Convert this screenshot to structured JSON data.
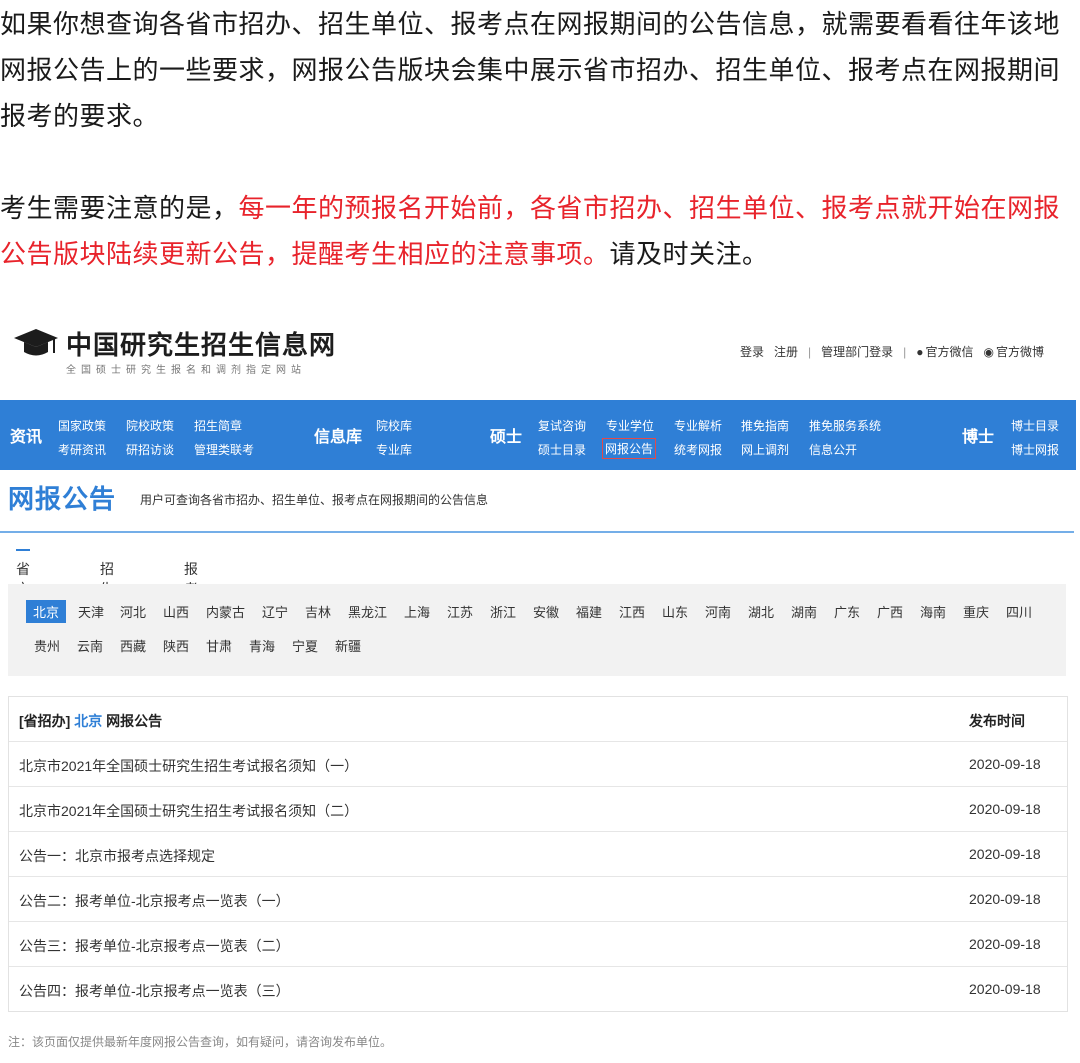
{
  "article": {
    "paragraph1": "如果你想查询各省市招办、招生单位、报考点在网报期间的公告信息，就需要看看往年该地网报公告上的一些要求，网报公告版块会集中展示省市招办、招生单位、报考点在网报期间报考的要求。",
    "p2_prefix": "考生需要注意的是，",
    "p2_red": "每一年的预报名开始前，各省市招办、招生单位、报考点就开始在网报公告版块陆续更新公告，提醒考生相应的注意事项。",
    "p2_suffix": "请及时关注。"
  },
  "site": {
    "logo_title": "中国研究生招生信息网",
    "logo_sub": "全国硕士研究生报名和调剂指定网站",
    "top_links": [
      "登录",
      "注册",
      "管理部门登录",
      "官方微信",
      "官方微博"
    ]
  },
  "nav": {
    "zixun": "资讯",
    "zixun_items": [
      "国家政策",
      "院校政策",
      "招生简章",
      "考研资讯",
      "研招访谈",
      "管理类联考"
    ],
    "xinxiku": "信息库",
    "xinxiku_items": [
      "院校库",
      "专业库"
    ],
    "shuoshi": "硕士",
    "shuoshi_items": [
      "复试咨询",
      "专业学位",
      "专业解析",
      "推免指南",
      "推免服务系统",
      "硕士目录",
      "网报公告",
      "统考网报",
      "网上调剂",
      "信息公开"
    ],
    "boshi": "博士",
    "boshi_items": [
      "博士目录",
      "博士网报"
    ]
  },
  "page": {
    "title": "网报公告",
    "desc": "用户可查询各省市招办、招生单位、报考点在网报期间的公告信息"
  },
  "tabs": [
    "省市招办",
    "招生单位",
    "报考点"
  ],
  "regions_row1": [
    "北京",
    "天津",
    "河北",
    "山西",
    "内蒙古",
    "辽宁",
    "吉林",
    "黑龙江",
    "上海",
    "江苏",
    "浙江",
    "安徽",
    "福建",
    "江西",
    "山东",
    "河南",
    "湖北",
    "湖南",
    "广东",
    "广西",
    "海南",
    "重庆",
    "四川"
  ],
  "regions_row2": [
    "贵州",
    "云南",
    "西藏",
    "陕西",
    "甘肃",
    "青海",
    "宁夏",
    "新疆"
  ],
  "table": {
    "head_prefix": "[省招办]",
    "head_region": "北京",
    "head_suffix": "网报公告",
    "head_date": "发布时间",
    "rows": [
      {
        "title": "北京市2021年全国硕士研究生招生考试报名须知（一）",
        "date": "2020-09-18"
      },
      {
        "title": "北京市2021年全国硕士研究生招生考试报名须知（二）",
        "date": "2020-09-18"
      },
      {
        "title": "公告一：北京市报考点选择规定",
        "date": "2020-09-18"
      },
      {
        "title": "公告二：报考单位-北京报考点一览表（一）",
        "date": "2020-09-18"
      },
      {
        "title": "公告三：报考单位-北京报考点一览表（二）",
        "date": "2020-09-18"
      },
      {
        "title": "公告四：报考单位-北京报考点一览表（三）",
        "date": "2020-09-18"
      }
    ]
  },
  "note": "注：该页面仅提供最新年度网报公告查询，如有疑问，请咨询发布单位。",
  "colors": {
    "brand_blue": "#2f7fd6",
    "highlight_red": "#e8232b"
  }
}
